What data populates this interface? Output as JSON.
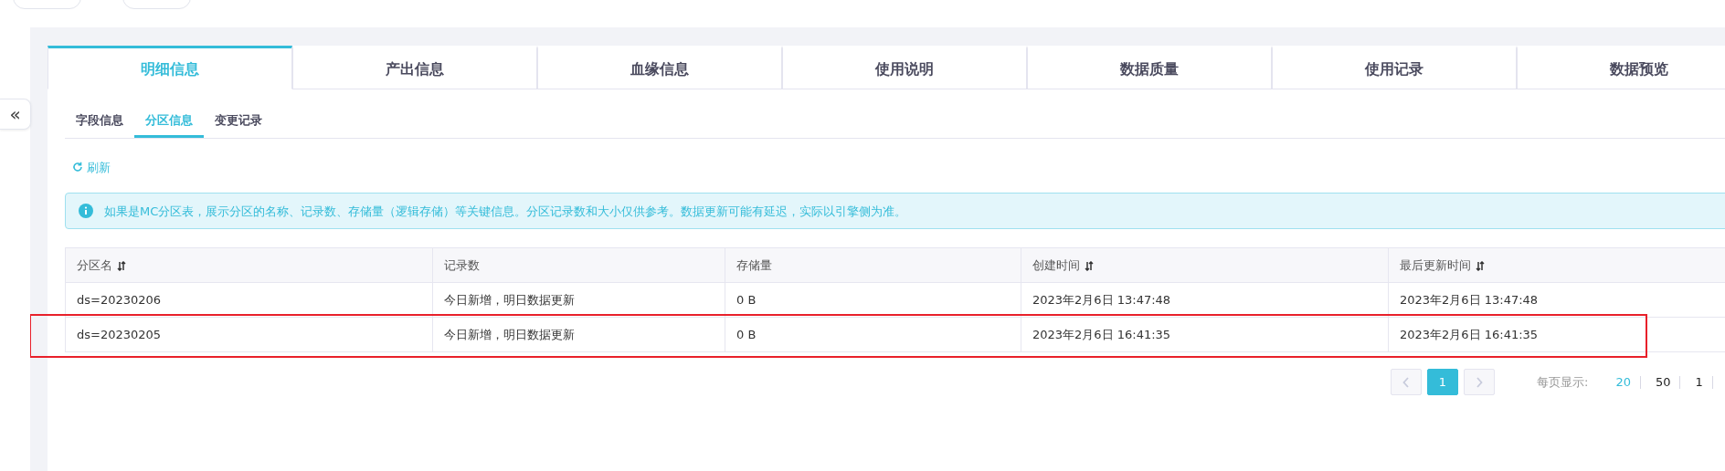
{
  "top_buttons": [
    {
      "kind": "outlined"
    },
    {
      "kind": "outlined"
    }
  ],
  "tabs": [
    {
      "label": "明细信息",
      "selected": true
    },
    {
      "label": "产出信息",
      "selected": false
    },
    {
      "label": "血缘信息",
      "selected": false
    },
    {
      "label": "使用说明",
      "selected": false
    },
    {
      "label": "数据质量",
      "selected": false
    },
    {
      "label": "使用记录",
      "selected": false
    },
    {
      "label": "数据预览",
      "selected": false
    }
  ],
  "subtabs": [
    {
      "label": "字段信息",
      "selected": false
    },
    {
      "label": "分区信息",
      "selected": true
    },
    {
      "label": "变更记录",
      "selected": false
    }
  ],
  "collapse_button": "«",
  "refresh_link": "刷新",
  "info_alert": "如果是MC分区表，展示分区的名称、记录数、存储量（逻辑存储）等关键信息。分区记录数和大小仅供参考。数据更新可能有延迟，实际以引擎侧为准。",
  "table": {
    "columns": [
      {
        "label": "分区名",
        "sortable": true
      },
      {
        "label": "记录数",
        "sortable": false
      },
      {
        "label": "存储量",
        "sortable": false
      },
      {
        "label": "创建时间",
        "sortable": true
      },
      {
        "label": "最后更新时间",
        "sortable": true
      }
    ],
    "rows": [
      {
        "cells": [
          "ds=20230206",
          "今日新增，明日数据更新",
          "0 B",
          "2023年2月6日 13:47:48",
          "2023年2月6日 13:47:48"
        ],
        "highlighted": false
      },
      {
        "cells": [
          "ds=20230205",
          "今日新增，明日数据更新",
          "0 B",
          "2023年2月6日 16:41:35",
          "2023年2月6日 16:41:35"
        ],
        "highlighted": true
      }
    ]
  },
  "pagination": {
    "pages": [
      {
        "label": "1",
        "selected": true
      }
    ],
    "page_size_label": "每页显示:",
    "page_sizes": [
      {
        "label": "20",
        "selected": true
      },
      {
        "label": "50",
        "selected": false
      },
      {
        "label": "1",
        "selected": false
      }
    ]
  }
}
